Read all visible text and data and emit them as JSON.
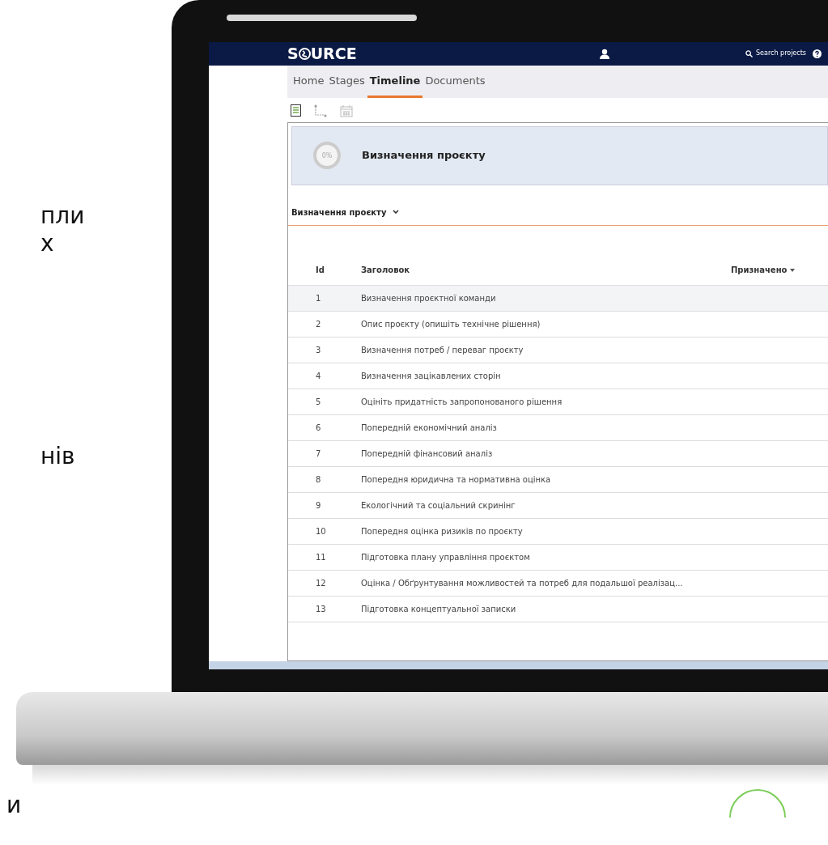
{
  "slide_text": [
    "пли",
    "х",
    "нів",
    "и"
  ],
  "app": {
    "logo": [
      "S",
      "URCE"
    ],
    "search_label": "Search projects",
    "tabs": [
      {
        "label": "Home",
        "selected": false
      },
      {
        "label": "Stages",
        "selected": false
      },
      {
        "label": "Timeline",
        "selected": true
      },
      {
        "label": "Documents",
        "selected": false
      }
    ],
    "stage": {
      "progress": "0%",
      "level": 0,
      "title": "Визначення проєкту"
    },
    "section_title": "Визначення проєкту",
    "table": {
      "columns": [
        "Id",
        "Заголовок",
        "Призначено"
      ],
      "rows": [
        {
          "id": "1",
          "title": "Визначення проєктної команди",
          "selected": true
        },
        {
          "id": "2",
          "title": "Опис проєкту (опишіть технічне рішення)",
          "selected": false
        },
        {
          "id": "3",
          "title": "Визначення потреб / переваг проєкту",
          "selected": false
        },
        {
          "id": "4",
          "title": "Визначення зацікавлених сторін",
          "selected": false
        },
        {
          "id": "5",
          "title": "Оцініть придатність запропонованого рішення",
          "selected": false
        },
        {
          "id": "6",
          "title": "Попередній економічний аналіз",
          "selected": false
        },
        {
          "id": "7",
          "title": "Попередній фінансовий аналіз",
          "selected": false
        },
        {
          "id": "8",
          "title": "Попередня юридична та нормативна оцінка",
          "selected": false
        },
        {
          "id": "9",
          "title": "Екологічний та соціальний скринінг",
          "selected": false
        },
        {
          "id": "10",
          "title": "Попередня оцінка ризиків по проєкту",
          "selected": false
        },
        {
          "id": "11",
          "title": "Підготовка плану управління проєктом",
          "selected": false
        },
        {
          "id": "12",
          "title": "Оцінка / Обґрунтування можливостей та потреб для подальшої реалізац...",
          "selected": false
        },
        {
          "id": "13",
          "title": "Підготовка концептуальної записки",
          "selected": false
        }
      ]
    }
  }
}
